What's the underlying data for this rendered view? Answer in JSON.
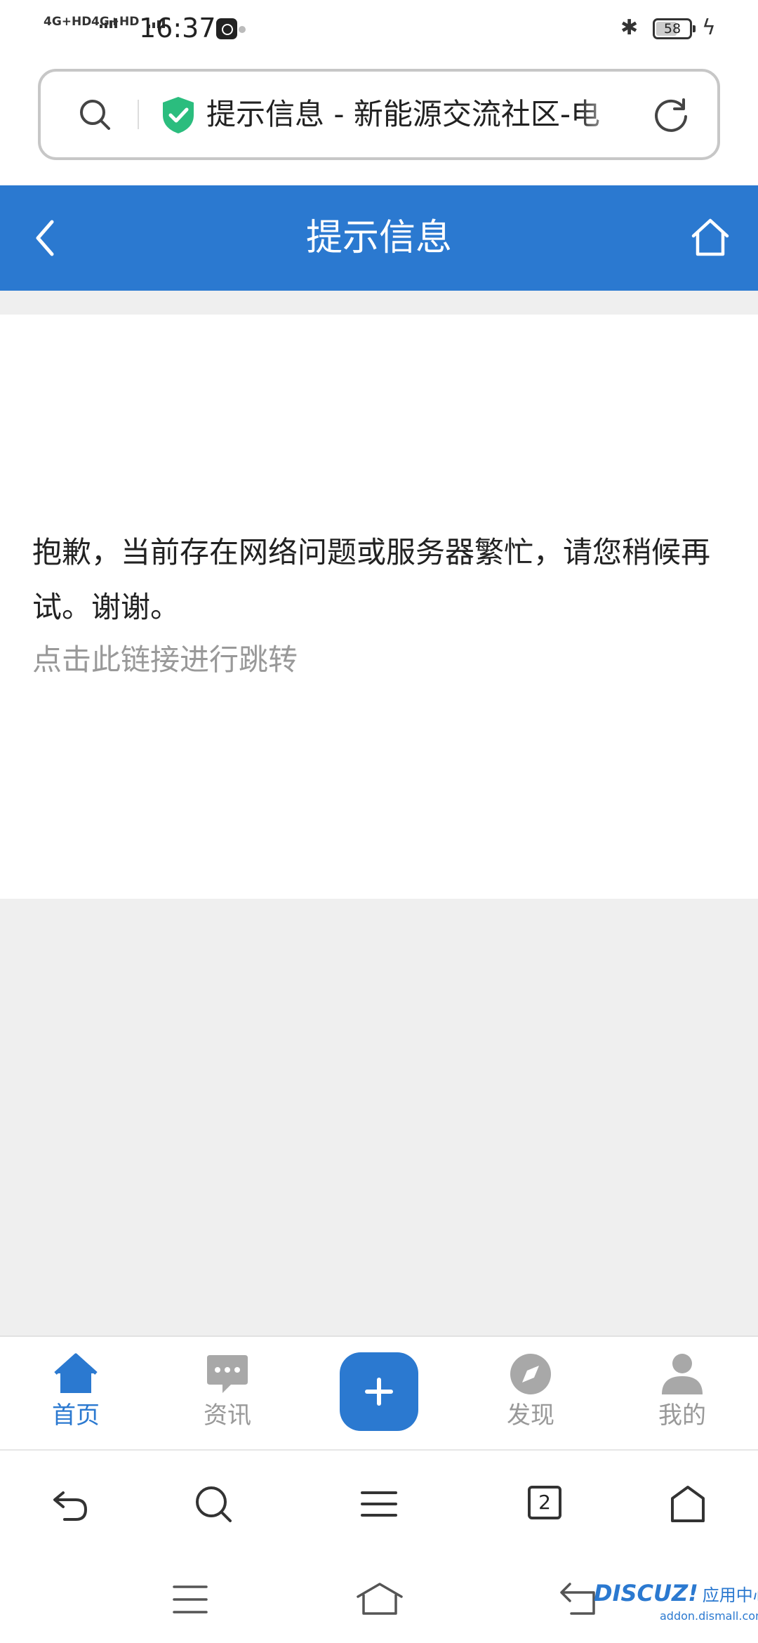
{
  "status_bar": {
    "signal_1": "4G+HD",
    "signal_2": "4G+HD",
    "time": "16:37",
    "battery": "58",
    "icons": [
      "bluetooth-icon",
      "battery-icon",
      "charging-icon"
    ]
  },
  "address_bar": {
    "text": "提示信息 - 新能源交流社区-电",
    "icons": [
      "search-icon",
      "secure-shield-icon",
      "reload-icon"
    ]
  },
  "header": {
    "title": "提示信息",
    "bg_color": "#2b79d0",
    "icons": [
      "back-icon",
      "home-icon"
    ]
  },
  "content": {
    "message": "抱歉，当前存在网络问题或服务器繁忙，请您稍候再试。谢谢。",
    "link_text": "点击此链接进行跳转"
  },
  "tab_bar": {
    "items": [
      {
        "label": "首页",
        "icon": "home-icon",
        "active": true
      },
      {
        "label": "资讯",
        "icon": "chat-bubble-icon",
        "active": false
      },
      {
        "label": "",
        "icon": "plus-icon",
        "active": false
      },
      {
        "label": "发现",
        "icon": "compass-icon",
        "active": false
      },
      {
        "label": "我的",
        "icon": "user-icon",
        "active": false
      }
    ],
    "active_color": "#2b79d0"
  },
  "browser_toolbar": {
    "tab_count": "2",
    "icons": [
      "back-arrow-icon",
      "search-icon",
      "menu-icon",
      "tabs-icon",
      "home-icon"
    ]
  },
  "watermark": {
    "brand": "DISCUZ!",
    "brand_cn": "应用中心",
    "url": "addon.dismall.com"
  }
}
